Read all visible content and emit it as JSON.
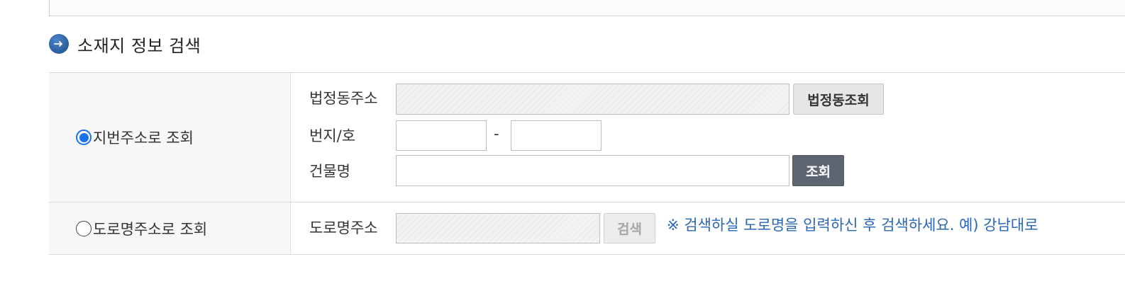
{
  "section": {
    "title": "소재지 정보 검색",
    "icon": "arrow-right-circle-icon"
  },
  "colors": {
    "title_icon": "#2f62a3",
    "radio_selected": "#1a73e8",
    "notice_text": "#2a66b5",
    "search_button_dark": "#5d6670"
  },
  "lot_address": {
    "option_label": "지번주소로 조회",
    "selected": true,
    "legal_dong_label": "법정동주소",
    "legal_dong_value": "",
    "legal_dong_button": "법정동조회",
    "lot_number_label": "번지/호",
    "lot_main_value": "",
    "lot_separator": "-",
    "lot_sub_value": "",
    "building_label": "건물명",
    "building_value": "",
    "search_button": "조회"
  },
  "road_address": {
    "option_label": "도로명주소로 조회",
    "selected": false,
    "road_label": "도로명주소",
    "road_value": "",
    "search_button": "검색",
    "notice": "※ 검색하실 도로명을 입력하신 후 검색하세요. 예) 강남대로"
  }
}
